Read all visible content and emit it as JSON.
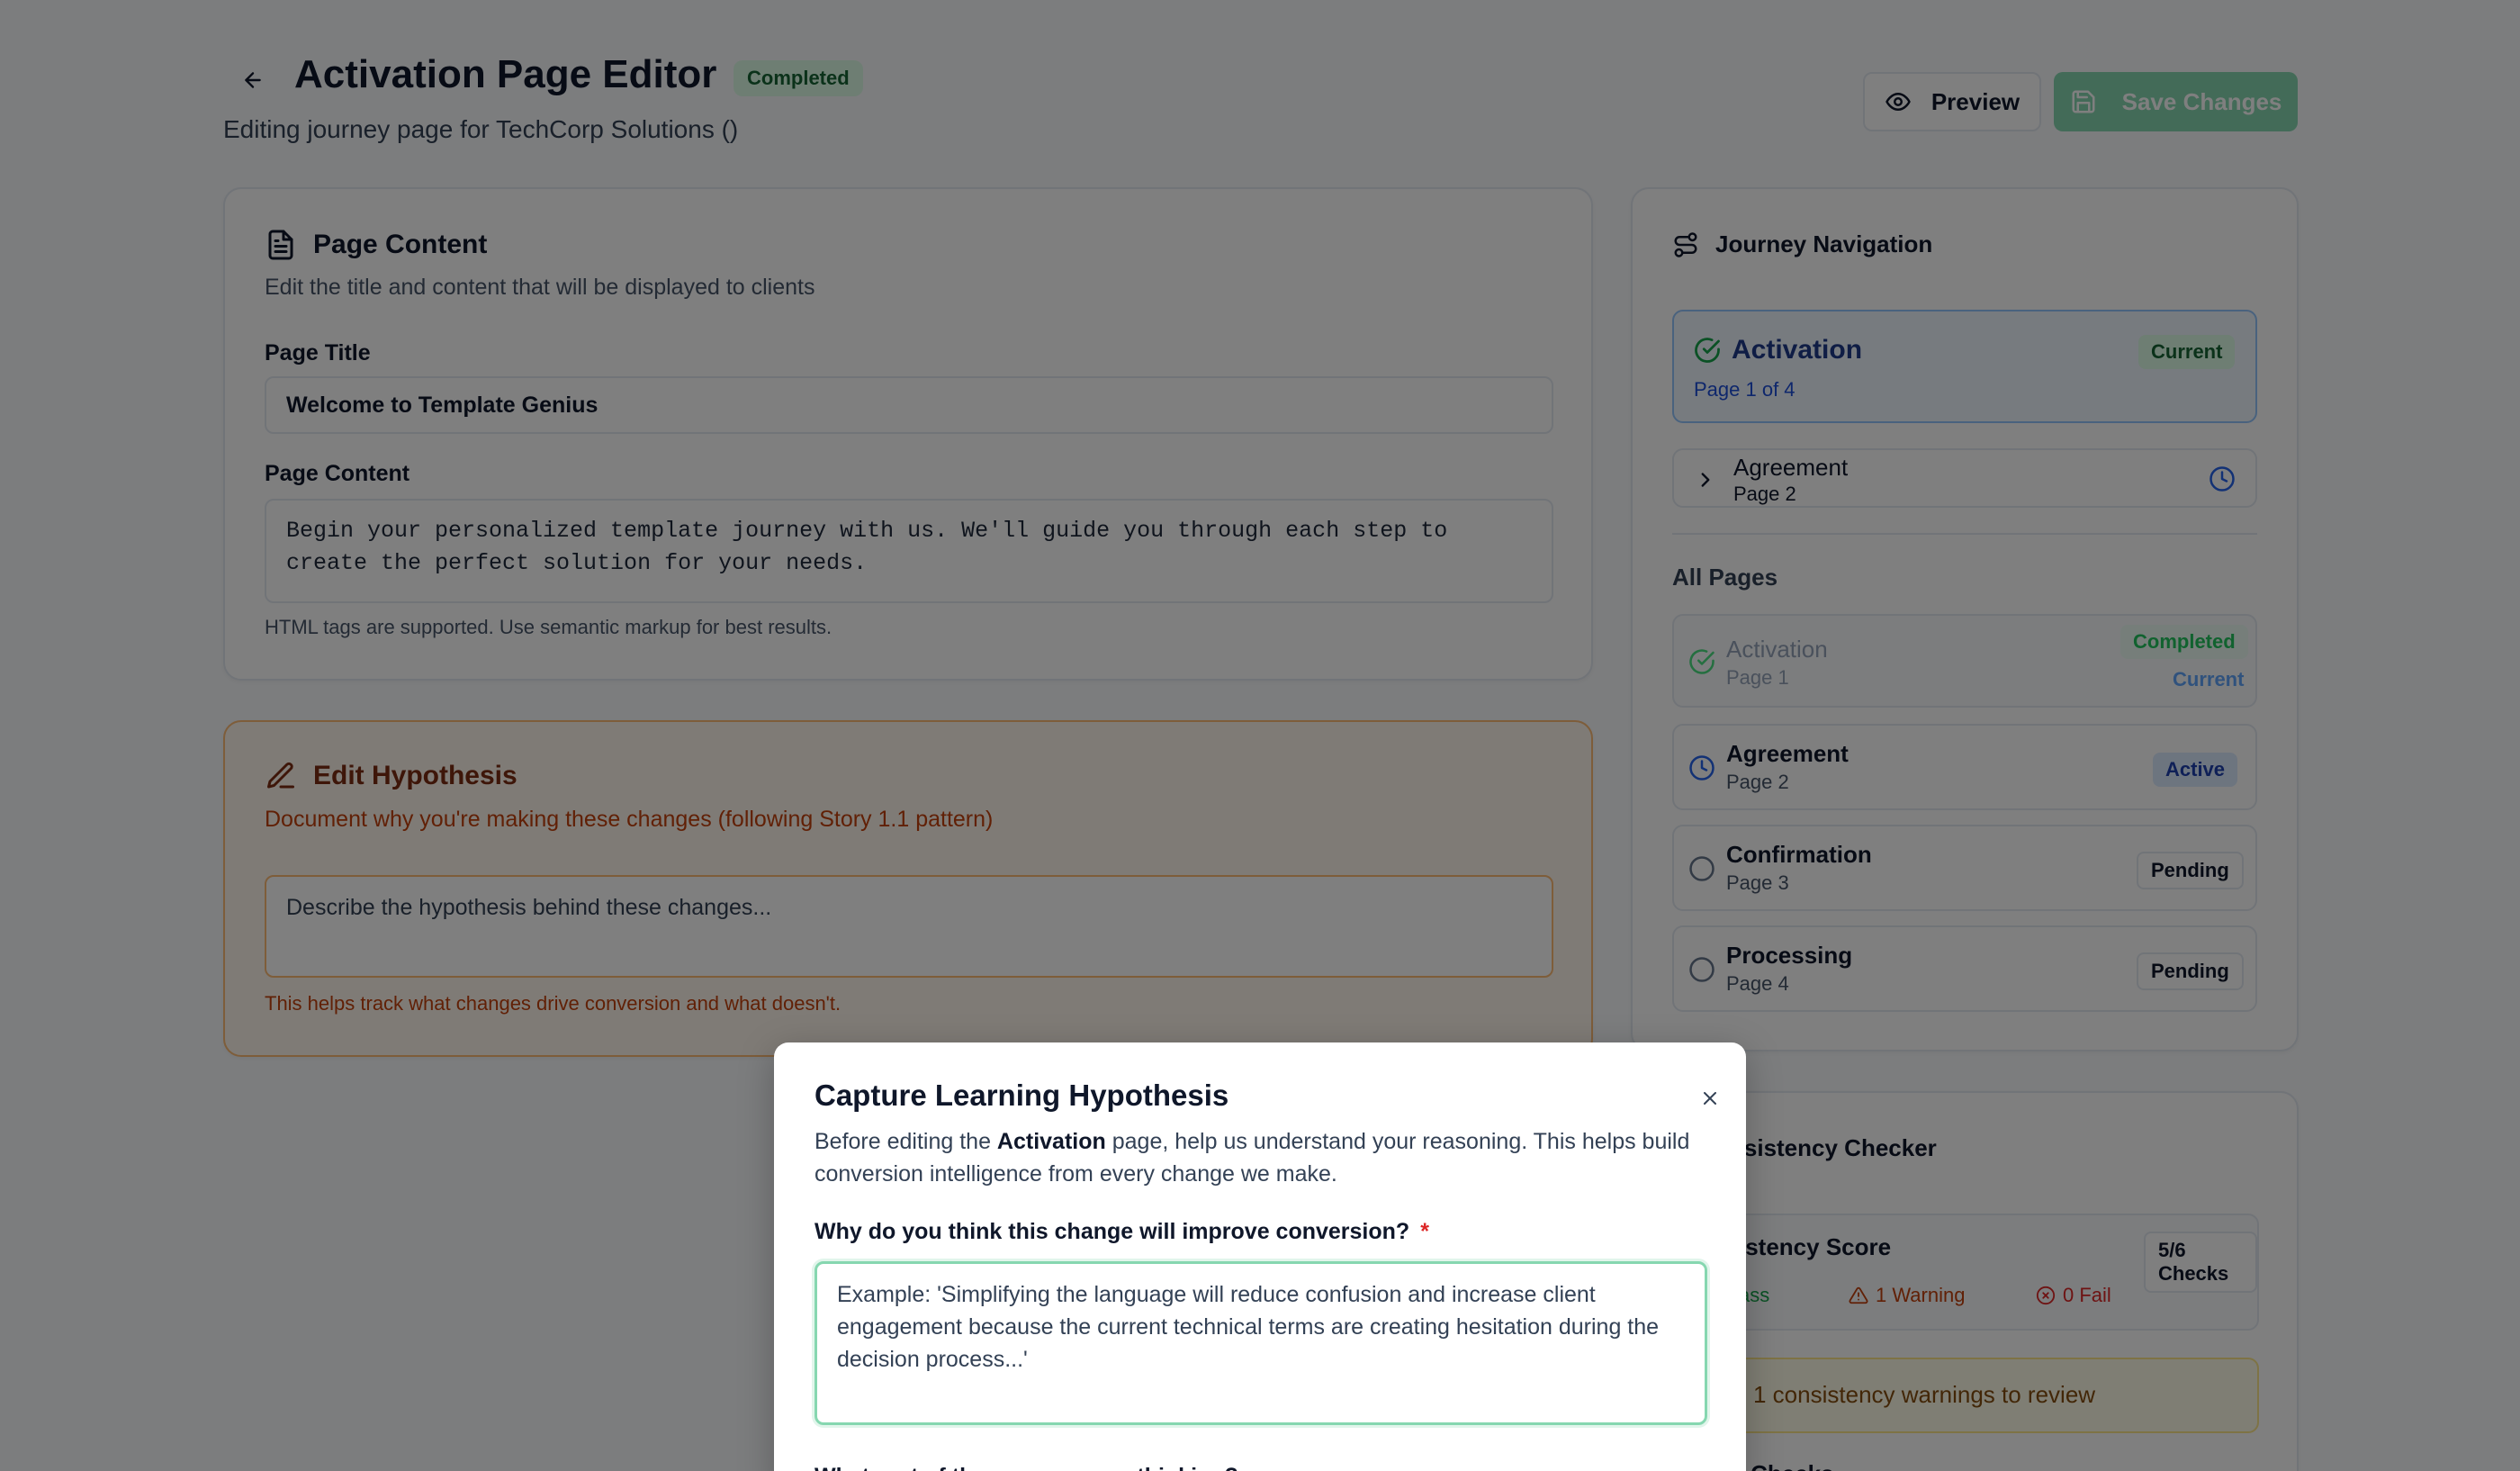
{
  "header": {
    "title": "Activation Page Editor",
    "status": "Completed",
    "subtitle": "Editing journey page for TechCorp Solutions ()",
    "preview_label": "Preview",
    "save_label": "Save Changes"
  },
  "page_content": {
    "title": "Page Content",
    "description": "Edit the title and content that will be displayed to clients",
    "page_title_label": "Page Title",
    "page_title_value": "Welcome to Template Genius",
    "content_label": "Page Content",
    "content_value": "Begin your personalized template journey with us. We'll guide you through each step to create the perfect solution for your needs.",
    "hint": "HTML tags are supported. Use semantic markup for best results."
  },
  "hypothesis": {
    "title": "Edit Hypothesis",
    "description": "Document why you're making these changes (following Story 1.1 pattern)",
    "placeholder": "Describe the hypothesis behind these changes...",
    "hint": "This helps track what changes drive conversion and what doesn't."
  },
  "journey": {
    "title": "Journey Navigation",
    "current": {
      "name": "Activation",
      "sub": "Page 1 of 4",
      "badge": "Current"
    },
    "next": {
      "name": "Agreement",
      "sub": "Page 2"
    },
    "all_pages_label": "All Pages",
    "pages": [
      {
        "name": "Activation",
        "sub": "Page 1",
        "badge": "Completed",
        "badge2": "Current"
      },
      {
        "name": "Agreement",
        "sub": "Page 2",
        "badge": "Active"
      },
      {
        "name": "Confirmation",
        "sub": "Page 3",
        "badge": "Pending"
      },
      {
        "name": "Processing",
        "sub": "Page 4",
        "badge": "Pending"
      }
    ]
  },
  "consistency": {
    "title_visible": "nsistency Checker",
    "score_label_visible": "istency Score",
    "score_badge": "5/6 Checks",
    "pass_visible": "ass",
    "warning": "1 Warning",
    "fail": "0 Fail",
    "alert_visible": "1 consistency warnings to review",
    "section_visible": "d Checks"
  },
  "modal": {
    "title": "Capture Learning Hypothesis",
    "desc_before": "Before editing the ",
    "desc_bold": "Activation",
    "desc_after": " page, help us understand your reasoning. This helps build conversion intelligence from every change we make.",
    "question": "Why do you think this change will improve conversion?",
    "required_mark": "*",
    "placeholder": "Example: 'Simplifying the language will reduce confusion and increase client engagement because the current technical terms are creating hesitation during the decision process...'",
    "next_question_partial": "What part of the page are you thinking?"
  },
  "colors": {
    "accent": "#86d7b0",
    "success": "#16a34a",
    "info": "#2563eb",
    "warning": "#c2410c",
    "danger": "#dc2626"
  }
}
